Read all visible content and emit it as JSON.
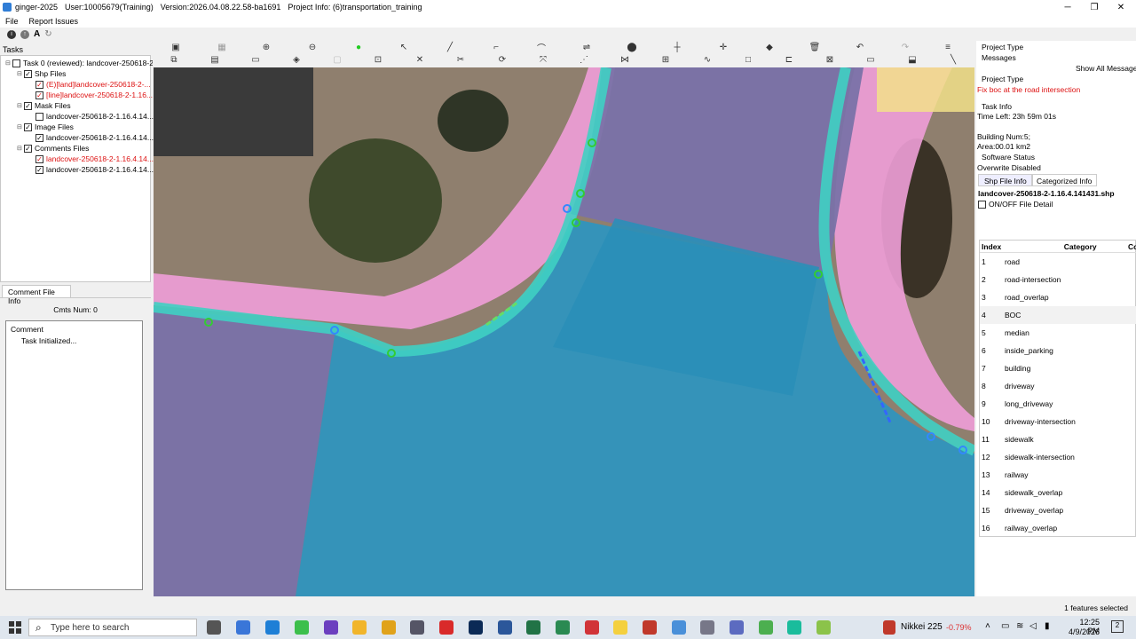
{
  "window": {
    "app": "ginger-2025",
    "user": "User:10005679(Training)",
    "version": "Version:2026.04.08.22.58-ba1691",
    "project": "Project Info: (6)transportation_training",
    "min": "─",
    "max": "❐",
    "close": "✕"
  },
  "menu": [
    "File",
    "Report Issues"
  ],
  "left": {
    "tasks_label": "Tasks",
    "tree": [
      {
        "exp": "⊟",
        "checked": false,
        "text": "Task 0 (reviewed): landcover-250618-2...",
        "level": 0,
        "red": false
      },
      {
        "exp": "⊟",
        "checked": true,
        "text": "Shp Files",
        "level": 1,
        "red": false
      },
      {
        "exp": "",
        "checked": true,
        "text": "(E)[land]landcover-250618-2-...",
        "level": 2,
        "red": true
      },
      {
        "exp": "",
        "checked": true,
        "text": "[line]landcover-250618-2-1.16...",
        "level": 2,
        "red": true
      },
      {
        "exp": "⊟",
        "checked": true,
        "text": "Mask Files",
        "level": 1,
        "red": false
      },
      {
        "exp": "",
        "checked": false,
        "text": "landcover-250618-2-1.16.4.14...",
        "level": 2,
        "red": false
      },
      {
        "exp": "⊟",
        "checked": true,
        "text": "Image Files",
        "level": 1,
        "red": false
      },
      {
        "exp": "",
        "checked": true,
        "text": "landcover-250618-2-1.16.4.14...",
        "level": 2,
        "red": false
      },
      {
        "exp": "⊟",
        "checked": true,
        "text": "Comments Files",
        "level": 1,
        "red": false
      },
      {
        "exp": "",
        "checked": true,
        "text": "landcover-250618-2-1.16.4.14...",
        "level": 2,
        "red": true
      },
      {
        "exp": "",
        "checked": true,
        "text": "landcover-250618-2-1.16.4.14...",
        "level": 2,
        "red": false
      }
    ],
    "comment_tab": "Comment File Info",
    "cmts_num": "Cmts Num:  0",
    "comment_header": "Comment",
    "comment_entry": "Task Initialized..."
  },
  "right": {
    "project_type_tab": "Project Type",
    "messages_tab": "Messages",
    "show_all": "Show All Messages",
    "project_type": "Project Type",
    "project_type_value": "Fix boc at the road intersection",
    "task_info": "Task Info",
    "time_left": "Time Left: 23h 59m 01s",
    "building_num": "Building Num:5;",
    "area": "Area:00.01 km2",
    "software_status": "Software Status",
    "overwrite": "Overwrite Disabled",
    "tab_shp": "Shp File Info",
    "tab_cat": "Categorized Info",
    "shp_name": "landcover-250618-2-1.16.4.141431.shp",
    "onoff": "ON/OFF File Detail",
    "col_index": "Index",
    "col_category": "Category",
    "col_extra": "Co",
    "categories": [
      {
        "i": "1",
        "c": "road"
      },
      {
        "i": "2",
        "c": "road-intersection"
      },
      {
        "i": "3",
        "c": "road_overlap"
      },
      {
        "i": "4",
        "c": "BOC"
      },
      {
        "i": "5",
        "c": "median"
      },
      {
        "i": "6",
        "c": "inside_parking"
      },
      {
        "i": "7",
        "c": "building"
      },
      {
        "i": "8",
        "c": "driveway"
      },
      {
        "i": "9",
        "c": "long_driveway"
      },
      {
        "i": "10",
        "c": "driveway-intersection"
      },
      {
        "i": "11",
        "c": "sidewalk"
      },
      {
        "i": "12",
        "c": "sidewalk-intersection"
      },
      {
        "i": "13",
        "c": "railway"
      },
      {
        "i": "14",
        "c": "sidewalk_overlap"
      },
      {
        "i": "15",
        "c": "driveway_overlap"
      },
      {
        "i": "16",
        "c": "railway_overlap"
      }
    ]
  },
  "status": {
    "features": "1 features selected"
  },
  "taskbar": {
    "search_placeholder": "Type here to search",
    "stock_name": "Nikkei 225",
    "stock_change": "-0.79%",
    "time": "12:25 PM",
    "date": "4/9/2026"
  },
  "colors": {
    "pink": "#ef9fd8",
    "teal": "#3fd0c3",
    "blue_area": "#2e95bf",
    "purple_area": "#7a72a8"
  }
}
